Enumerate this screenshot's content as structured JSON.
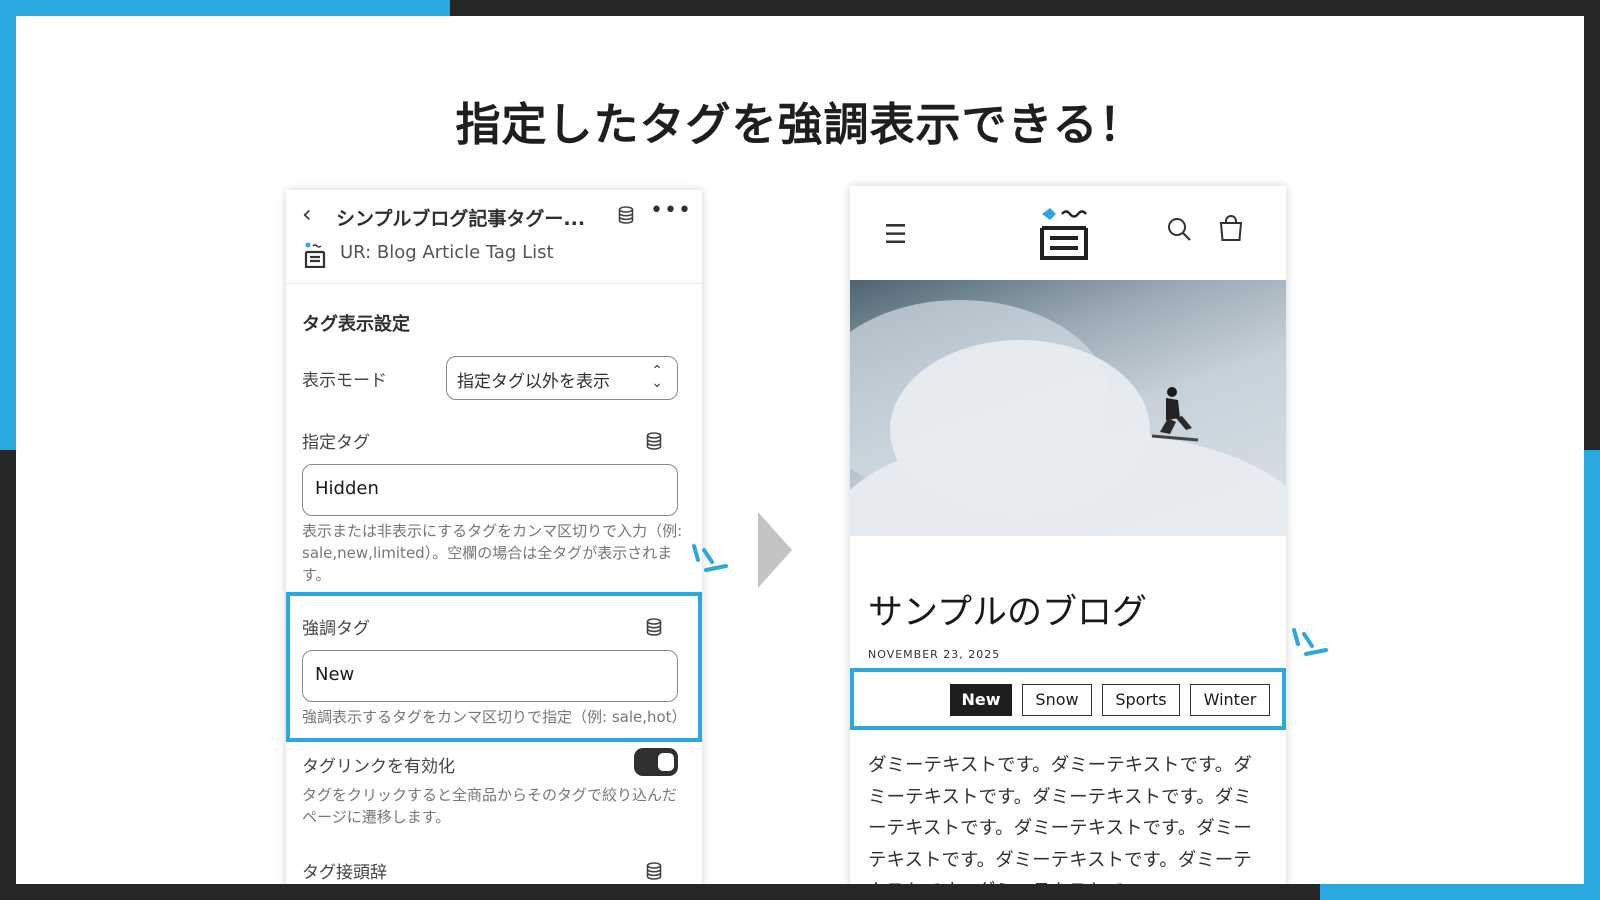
{
  "headline": "指定したタグを強調表示できる！",
  "colors": {
    "accent": "#2ba8e0",
    "frame": "#262626",
    "toggle_on": "#303030"
  },
  "settings_panel": {
    "title": "シンプルブログ記事タグー...",
    "app_name": "UR: Blog Article Tag List",
    "section_title": "タグ表示設定",
    "display_mode": {
      "label": "表示モード",
      "value": "指定タグ以外を表示"
    },
    "specified_tags": {
      "label": "指定タグ",
      "value": "Hidden",
      "help": "表示または非表示にするタグをカンマ区切りで入力（例: sale,new,limited）。空欄の場合は全タグが表示されます。"
    },
    "highlight_tags": {
      "label": "強調タグ",
      "value": "New",
      "help": "強調表示するタグをカンマ区切りで指定（例: sale,hot）"
    },
    "tag_links": {
      "label": "タグリンクを有効化",
      "enabled": true,
      "help": "タグをクリックすると全商品からそのタグで絞り込んだページに遷移します。"
    },
    "tag_prefix": {
      "label": "タグ接頭辞"
    }
  },
  "preview": {
    "blog_title": "サンプルのブログ",
    "date": "NOVEMBER 23, 2025",
    "tags": [
      {
        "label": "New",
        "highlighted": true
      },
      {
        "label": "Snow",
        "highlighted": false
      },
      {
        "label": "Sports",
        "highlighted": false
      },
      {
        "label": "Winter",
        "highlighted": false
      }
    ],
    "body": "ダミーテキストです。ダミーテキストです。ダミーテキストです。ダミーテキストです。ダミーテキストです。ダミーテキストです。ダミーテキストです。ダミーテキストです。ダミーテキストです。ダミーテキストで"
  }
}
